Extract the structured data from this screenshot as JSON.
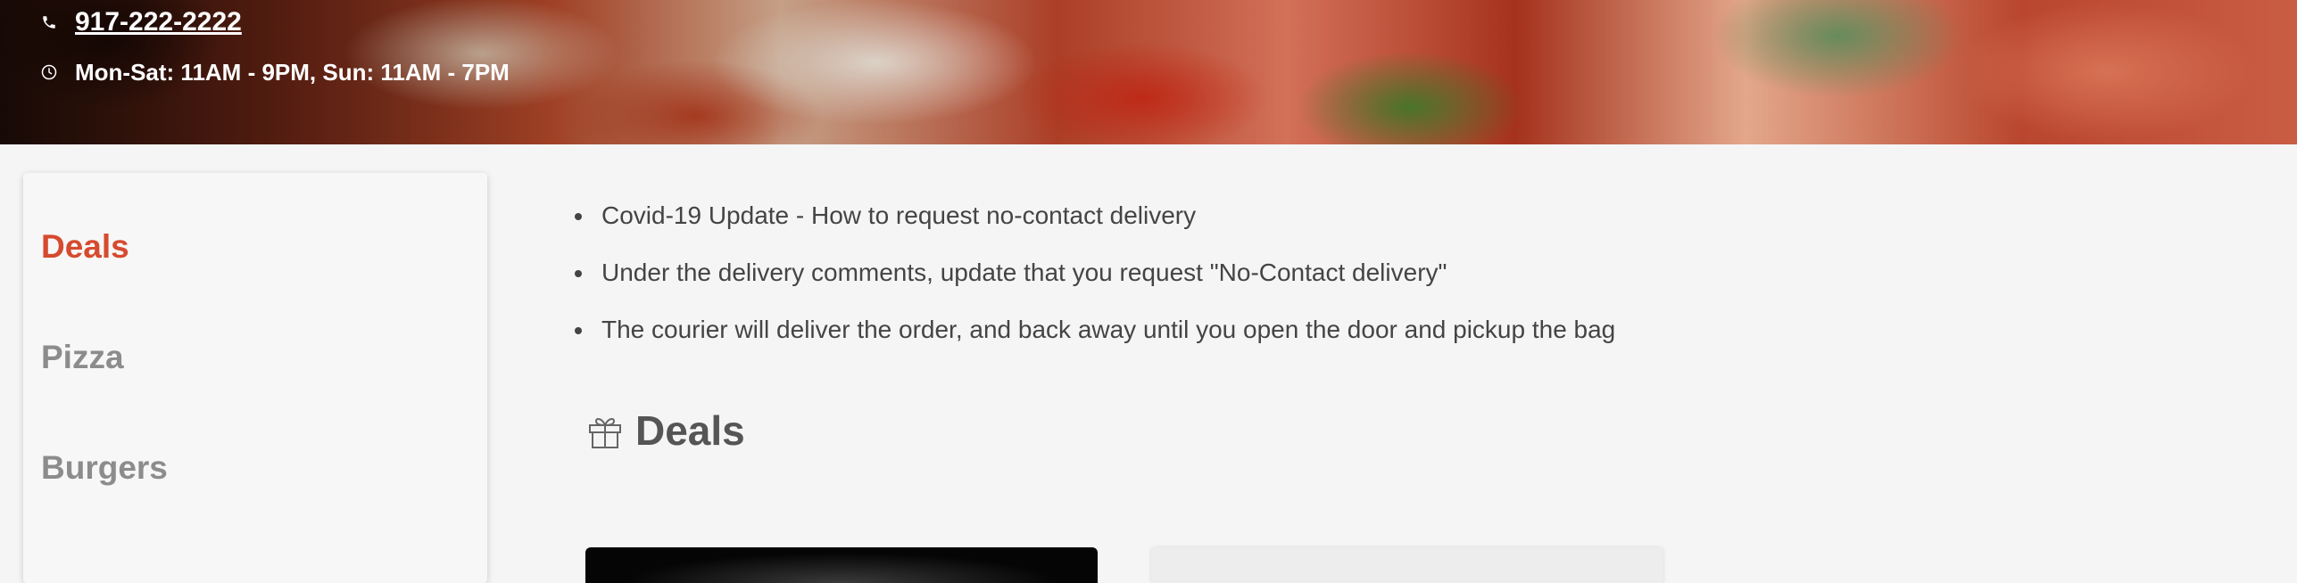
{
  "header": {
    "phone": "917-222-2222",
    "hours": "Mon-Sat: 11AM - 9PM, Sun: 11AM - 7PM"
  },
  "sidebar": {
    "items": [
      {
        "label": "Deals",
        "active": true
      },
      {
        "label": "Pizza",
        "active": false
      },
      {
        "label": "Burgers",
        "active": false
      }
    ]
  },
  "notices": [
    "Covid-19 Update - How to request no-contact delivery",
    "Under the delivery comments, update that you request \"No-Contact delivery\"",
    "The courier will deliver the order, and back away until you open the door and pickup the bag"
  ],
  "section": {
    "title": "Deals",
    "icon": "gift-icon"
  },
  "colors": {
    "accent": "#d64a2f",
    "sidebar_inactive": "#8c8c8c",
    "text": "#444444",
    "background": "#f5f5f5"
  }
}
